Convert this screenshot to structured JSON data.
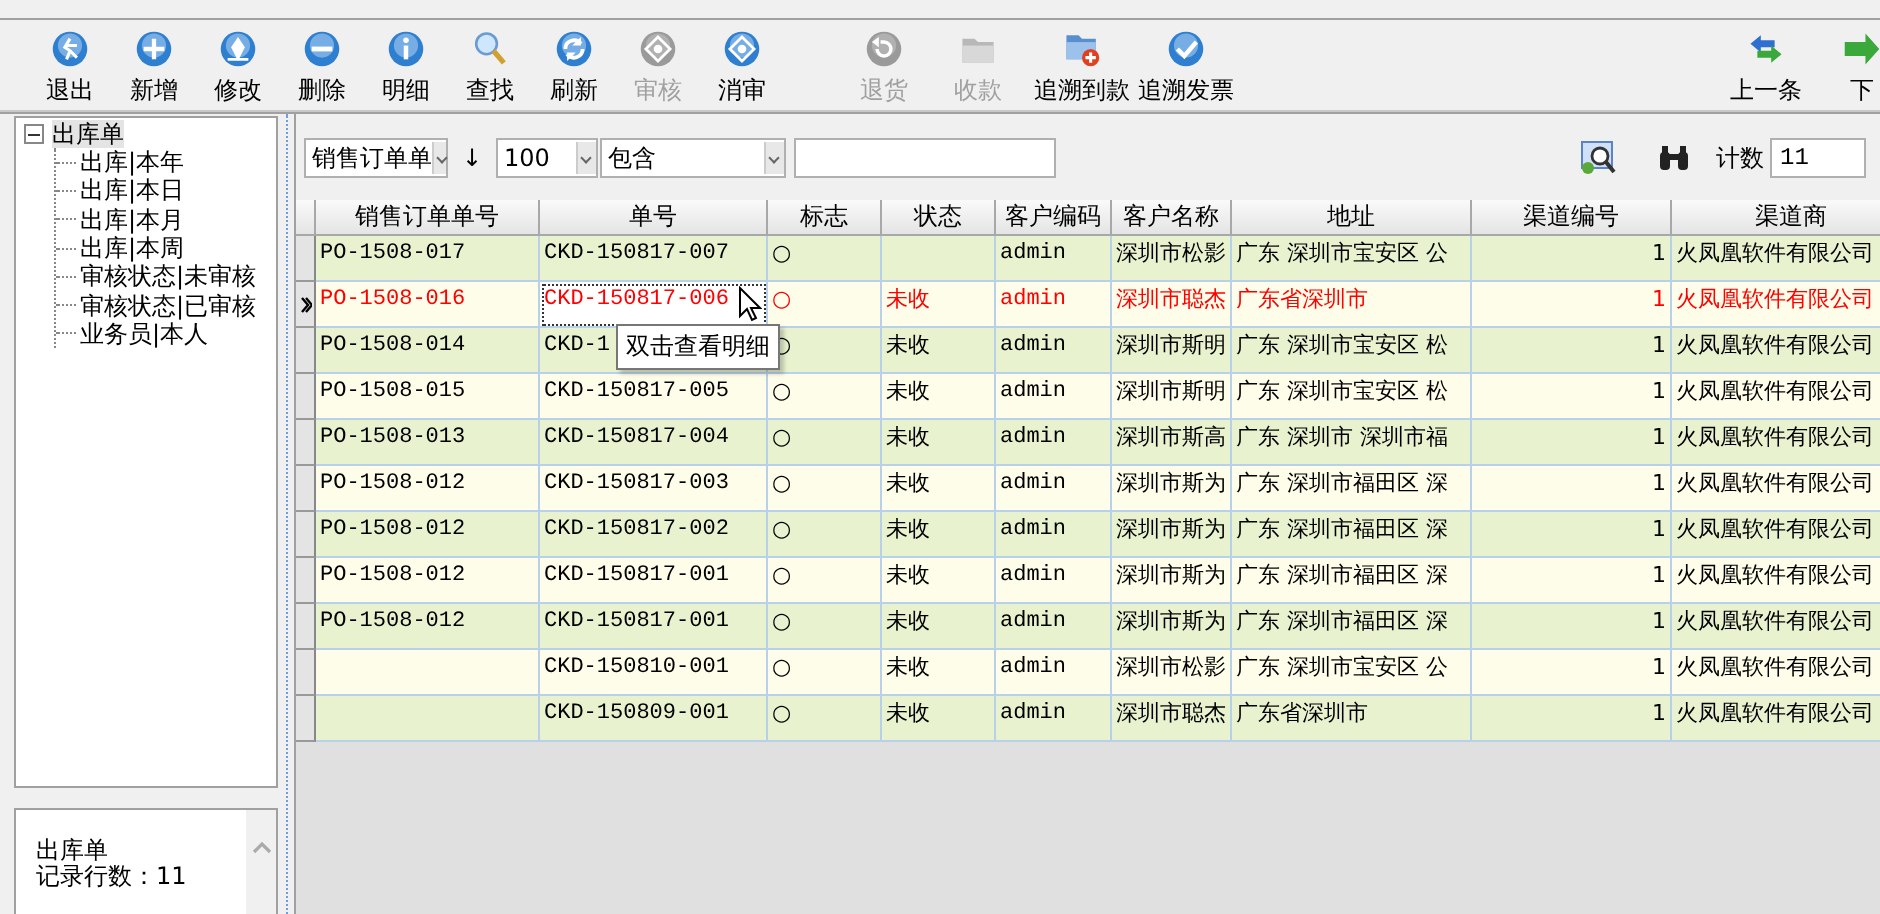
{
  "toolbar": {
    "buttons": [
      {
        "label": "退出",
        "disabled": false
      },
      {
        "label": "新增",
        "disabled": false
      },
      {
        "label": "修改",
        "disabled": false
      },
      {
        "label": "删除",
        "disabled": false
      },
      {
        "label": "明细",
        "disabled": false
      },
      {
        "label": "查找",
        "disabled": false
      },
      {
        "label": "刷新",
        "disabled": false
      },
      {
        "label": "审核",
        "disabled": true
      },
      {
        "label": "消审",
        "disabled": false
      },
      {
        "label": "退货",
        "disabled": true
      },
      {
        "label": "收款",
        "disabled": true
      },
      {
        "label": "追溯到款",
        "disabled": false
      },
      {
        "label": "追溯发票",
        "disabled": false
      }
    ],
    "nav": [
      {
        "label": "上一条"
      },
      {
        "label": "下"
      }
    ]
  },
  "tree": {
    "label": "出库单",
    "expanded": true,
    "children": [
      {
        "label": "出库|本年"
      },
      {
        "label": "出库|本日"
      },
      {
        "label": "出库|本月"
      },
      {
        "label": "出库|本周"
      },
      {
        "label": "审核状态|未审核"
      },
      {
        "label": "审核状态|已审核"
      },
      {
        "label": "业务员|本人"
      }
    ]
  },
  "info": {
    "title": "出库单",
    "record_count": "记录行数：11"
  },
  "filter": {
    "field": "销售订单单",
    "sort_arrow": "↓",
    "limit": "100",
    "match": "包含",
    "count_label": "计数",
    "count": "11"
  },
  "grid": {
    "columns": [
      "销售订单单号",
      "单号",
      "标志",
      "状态",
      "客户编码",
      "客户名称",
      "地址",
      "渠道编号",
      "渠道商"
    ],
    "rows": [
      {
        "selected": false,
        "cells": [
          "PO-1508-017",
          "CKD-150817-007",
          "○",
          "",
          "admin",
          "深圳市松影",
          "广东 深圳市宝安区 公",
          "1",
          "火凤凰软件有限公司"
        ]
      },
      {
        "selected": true,
        "cells": [
          "PO-1508-016",
          "CKD-150817-006",
          "○",
          "未收",
          "admin",
          "深圳市聪杰",
          "广东省深圳市",
          "1",
          "火凤凰软件有限公司"
        ]
      },
      {
        "selected": false,
        "cells": [
          "PO-1508-014",
          "CKD-1",
          "○",
          "未收",
          "admin",
          "深圳市斯明",
          "广东 深圳市宝安区 松",
          "1",
          "火凤凰软件有限公司"
        ]
      },
      {
        "selected": false,
        "cells": [
          "PO-1508-015",
          "CKD-150817-005",
          "○",
          "未收",
          "admin",
          "深圳市斯明",
          "广东 深圳市宝安区 松",
          "1",
          "火凤凰软件有限公司"
        ]
      },
      {
        "selected": false,
        "cells": [
          "PO-1508-013",
          "CKD-150817-004",
          "○",
          "未收",
          "admin",
          "深圳市斯高",
          "广东 深圳市 深圳市福",
          "1",
          "火凤凰软件有限公司"
        ]
      },
      {
        "selected": false,
        "cells": [
          "PO-1508-012",
          "CKD-150817-003",
          "○",
          "未收",
          "admin",
          "深圳市斯为",
          "广东 深圳市福田区 深",
          "1",
          "火凤凰软件有限公司"
        ]
      },
      {
        "selected": false,
        "cells": [
          "PO-1508-012",
          "CKD-150817-002",
          "○",
          "未收",
          "admin",
          "深圳市斯为",
          "广东 深圳市福田区 深",
          "1",
          "火凤凰软件有限公司"
        ]
      },
      {
        "selected": false,
        "cells": [
          "PO-1508-012",
          "CKD-150817-001",
          "○",
          "未收",
          "admin",
          "深圳市斯为",
          "广东 深圳市福田区 深",
          "1",
          "火凤凰软件有限公司"
        ]
      },
      {
        "selected": false,
        "cells": [
          "PO-1508-012",
          "CKD-150817-001",
          "○",
          "未收",
          "admin",
          "深圳市斯为",
          "广东 深圳市福田区 深",
          "1",
          "火凤凰软件有限公司"
        ]
      },
      {
        "selected": false,
        "cells": [
          "",
          "CKD-150810-001",
          "○",
          "未收",
          "admin",
          "深圳市松影",
          "广东 深圳市宝安区 公",
          "1",
          "火凤凰软件有限公司"
        ]
      },
      {
        "selected": false,
        "cells": [
          "",
          "CKD-150809-001",
          "○",
          "未收",
          "admin",
          "深圳市聪杰",
          "广东省深圳市",
          "1",
          "火凤凰软件有限公司"
        ]
      }
    ],
    "tooltip": "双击查看明细"
  }
}
